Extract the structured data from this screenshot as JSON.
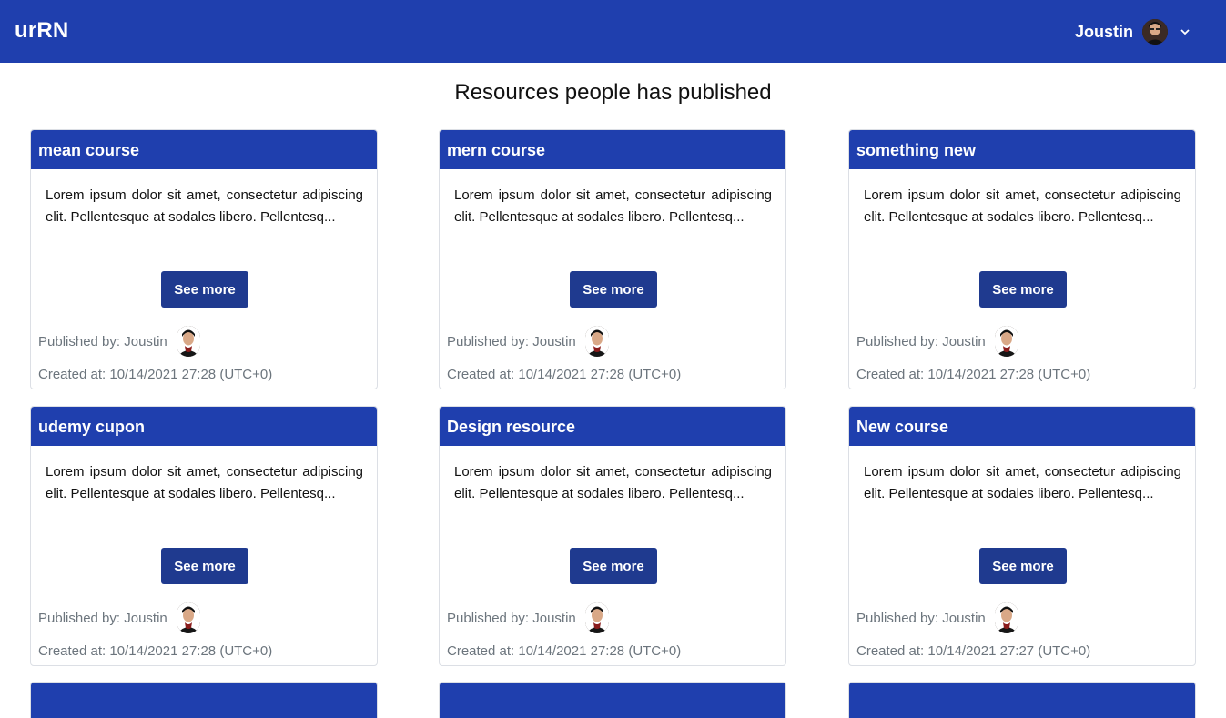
{
  "navbar": {
    "brand": "urRN",
    "user_name": "Joustin"
  },
  "page": {
    "title": "Resources people has published"
  },
  "labels": {
    "see_more": "See more"
  },
  "cards": [
    {
      "title": "mean course",
      "body": "Lorem ipsum dolor sit amet, consectetur adipiscing elit. Pellentesque at sodales libero. Pellentesq...",
      "published": "Published by: Joustin",
      "created": "Created at: 10/14/2021 27:28 (UTC+0)"
    },
    {
      "title": "mern course",
      "body": "Lorem ipsum dolor sit amet, consectetur adipiscing elit. Pellentesque at sodales libero. Pellentesq...",
      "published": "Published by: Joustin",
      "created": "Created at: 10/14/2021 27:28 (UTC+0)"
    },
    {
      "title": "something new",
      "body": "Lorem ipsum dolor sit amet, consectetur adipiscing elit. Pellentesque at sodales libero. Pellentesq...",
      "published": "Published by: Joustin",
      "created": "Created at: 10/14/2021 27:28 (UTC+0)"
    },
    {
      "title": "udemy cupon",
      "body": "Lorem ipsum dolor sit amet, consectetur adipiscing elit. Pellentesque at sodales libero. Pellentesq...",
      "published": "Published by: Joustin",
      "created": "Created at: 10/14/2021 27:28 (UTC+0)"
    },
    {
      "title": "Design resource",
      "body": "Lorem ipsum dolor sit amet, consectetur adipiscing elit. Pellentesque at sodales libero. Pellentesq...",
      "published": "Published by: Joustin",
      "created": "Created at: 10/14/2021 27:28 (UTC+0)"
    },
    {
      "title": "New course",
      "body": "Lorem ipsum dolor sit amet, consectetur adipiscing elit. Pellentesque at sodales libero. Pellentesq...",
      "published": "Published by: Joustin",
      "created": "Created at: 10/14/2021 27:27 (UTC+0)"
    }
  ],
  "colors": {
    "navbar": "#1f3fae",
    "button": "#1f3a8f",
    "muted_text": "#6c757d"
  },
  "icons": {
    "avatar": "user-avatar-icon",
    "dropdown": "chevron-down-icon"
  }
}
